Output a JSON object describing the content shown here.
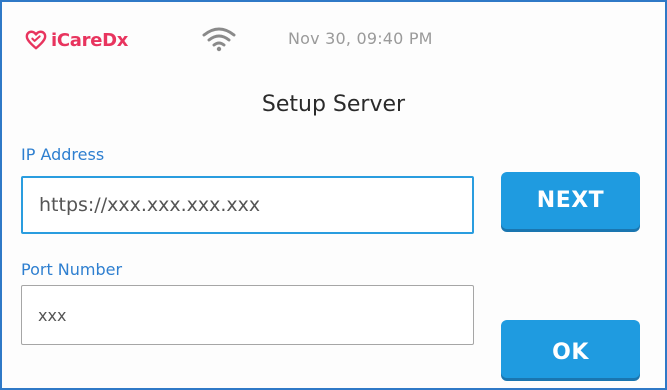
{
  "status_bar": {
    "logo_text": "iCareDx",
    "logo_color": "#e8345e",
    "datetime": "Nov 30, 09:40 PM",
    "wifi_icon": "wifi-icon"
  },
  "title": "Setup Server",
  "fields": {
    "ip": {
      "label": "IP Address",
      "placeholder": "https://xxx.xxx.xxx.xxx",
      "value": ""
    },
    "port": {
      "label": "Port Number",
      "placeholder": "xxx",
      "value": ""
    }
  },
  "buttons": {
    "next": "NEXT",
    "ok": "OK"
  },
  "colors": {
    "accent": "#1f9be0",
    "label": "#2e7fd0",
    "frame": "#2f79c7"
  }
}
